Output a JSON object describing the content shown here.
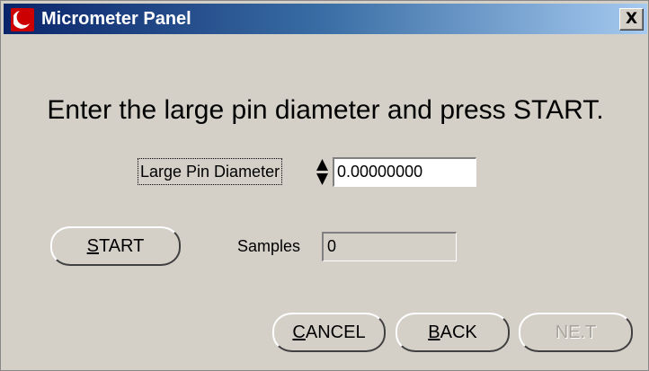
{
  "window": {
    "title": "Micrometer Panel",
    "close_label": "X"
  },
  "instruction": "Enter the large pin diameter and press START.",
  "diameter": {
    "label": "Large Pin Diameter",
    "value": "0.00000000"
  },
  "samples": {
    "label": "Samples",
    "value": "0"
  },
  "buttons": {
    "start": {
      "mnemonic": "S",
      "rest": "TART"
    },
    "cancel": {
      "mnemonic": "C",
      "rest": "ANCEL"
    },
    "back": {
      "mnemonic": "B",
      "rest": "ACK"
    },
    "next": {
      "label": "NE.T"
    }
  },
  "icons": {
    "app": "moon-logo-icon",
    "close": "close-icon",
    "spin_up": "triangle-up-icon",
    "spin_down": "triangle-down-icon"
  },
  "colors": {
    "titlebar_start": "#0a246a",
    "titlebar_end": "#a6caf0",
    "face": "#d4d0c8",
    "app_icon": "#cc0000"
  }
}
